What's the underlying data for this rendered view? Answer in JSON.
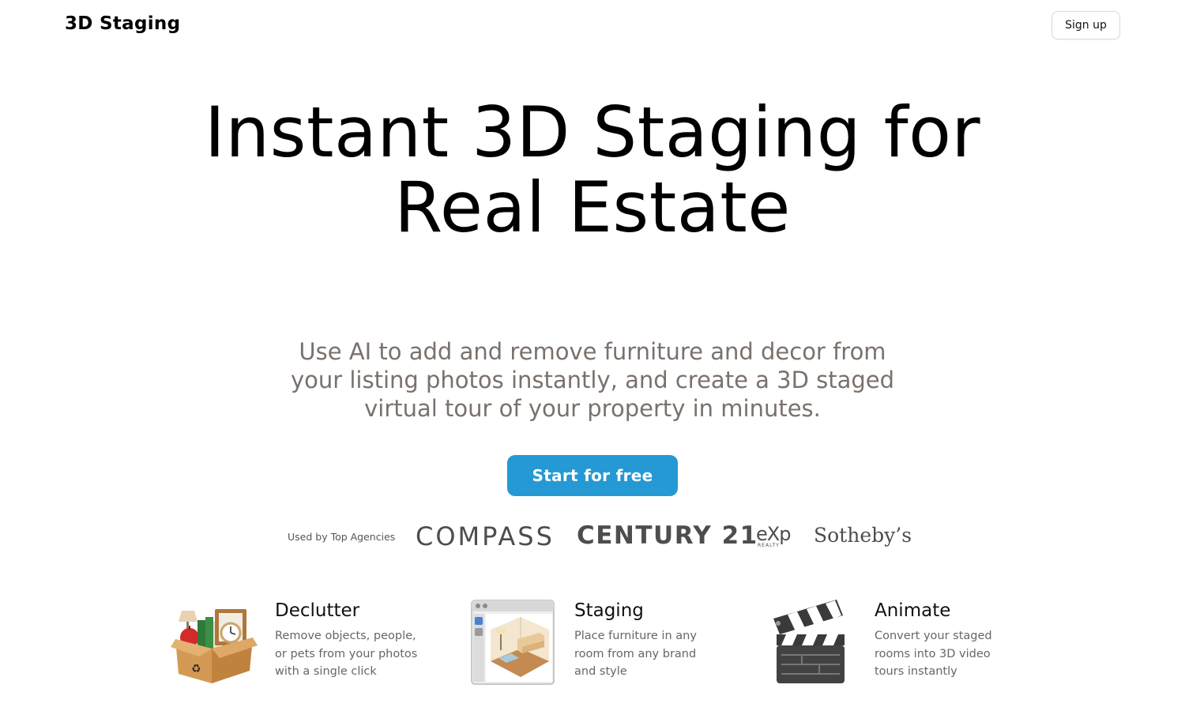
{
  "header": {
    "brand": "3D Staging",
    "signup_label": "Sign up"
  },
  "hero": {
    "title": "Instant 3D Staging for Real Estate",
    "subtitle": "Use AI to add and remove furniture and decor from your listing photos instantly, and create a 3D staged virtual tour of your property in minutes.",
    "cta_label": "Start for free"
  },
  "agencies": {
    "label": "Used by Top Agencies",
    "logos": {
      "compass": "COMPASS",
      "century21": "CENTURY 21",
      "exp": "eXp",
      "exp_sub": "REALTY",
      "sothebys": "Sotheby’s"
    }
  },
  "features": [
    {
      "icon": "moving-box-icon",
      "title": "Declutter",
      "description": "Remove objects, people, or pets from your photos with a single click"
    },
    {
      "icon": "room-window-icon",
      "title": "Staging",
      "description": "Place furniture in any room from any brand and style"
    },
    {
      "icon": "clapperboard-icon",
      "title": "Animate",
      "description": "Convert your staged rooms into 3D video tours instantly"
    }
  ],
  "colors": {
    "accent": "#2499d4",
    "subtitle": "#7a716c"
  }
}
